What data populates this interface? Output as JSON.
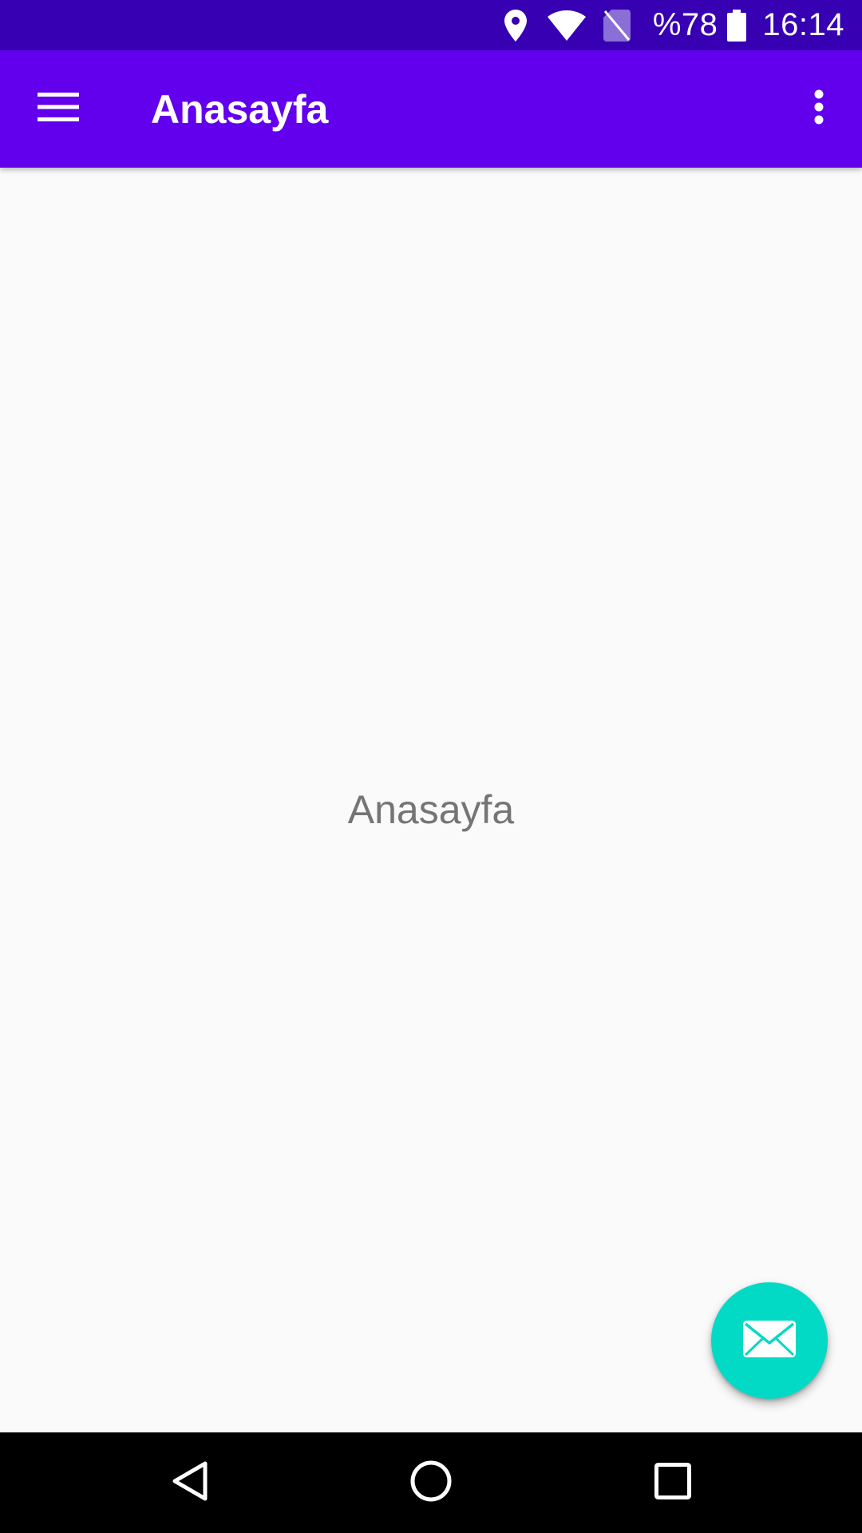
{
  "status_bar": {
    "icons": [
      "location-icon",
      "wifi-icon",
      "no-sim-icon",
      "battery-icon"
    ],
    "battery_percent": "%78",
    "time": "16:14"
  },
  "app_bar": {
    "title": "Anasayfa",
    "nav_icon": "menu-icon",
    "overflow_icon": "more-vert-icon",
    "color": "#6200ee"
  },
  "content": {
    "text": "Anasayfa"
  },
  "fab": {
    "icon": "mail-icon",
    "color": "#03dac5"
  },
  "nav_bar": {
    "buttons": [
      "back-icon",
      "home-icon",
      "recents-icon"
    ]
  },
  "colors": {
    "status_bar": "#3700b3",
    "background": "#fafafa"
  }
}
